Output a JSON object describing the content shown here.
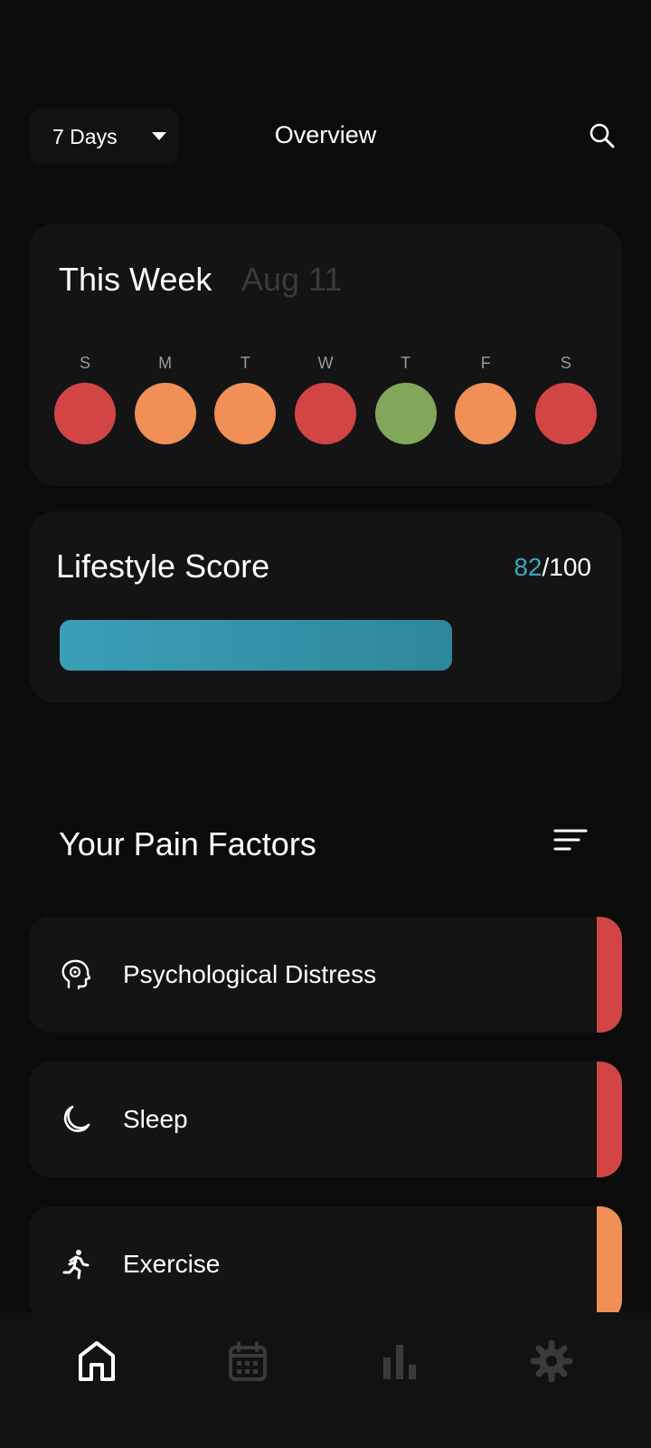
{
  "header": {
    "range_label": "7 Days",
    "title": "Overview",
    "search_icon": "search-icon"
  },
  "week": {
    "title": "This Week",
    "date": "Aug 11",
    "days": [
      {
        "letter": "S",
        "color": "#d24545"
      },
      {
        "letter": "M",
        "color": "#f08f56"
      },
      {
        "letter": "T",
        "color": "#f08f56"
      },
      {
        "letter": "W",
        "color": "#d24545"
      },
      {
        "letter": "T",
        "color": "#82a65a"
      },
      {
        "letter": "F",
        "color": "#f08f56"
      },
      {
        "letter": "S",
        "color": "#d24545"
      }
    ]
  },
  "lifestyle": {
    "title": "Lifestyle Score",
    "score": "82",
    "max": "/100",
    "fill_fraction": 0.735,
    "color": "#3aa7c2"
  },
  "factors": {
    "title": "Your Pain Factors",
    "sort_icon": "sort-icon",
    "items": [
      {
        "label": "Psychological Distress",
        "icon": "head-brain-icon",
        "color": "#d24545"
      },
      {
        "label": "Sleep",
        "icon": "moon-icon",
        "color": "#d24545"
      },
      {
        "label": "Exercise",
        "icon": "running-icon",
        "color": "#f08f56"
      }
    ]
  },
  "nav": {
    "items": [
      {
        "icon": "home-icon",
        "active": true
      },
      {
        "icon": "calendar-icon",
        "active": false
      },
      {
        "icon": "bar-chart-icon",
        "active": false
      },
      {
        "icon": "gear-icon",
        "active": false
      }
    ]
  }
}
